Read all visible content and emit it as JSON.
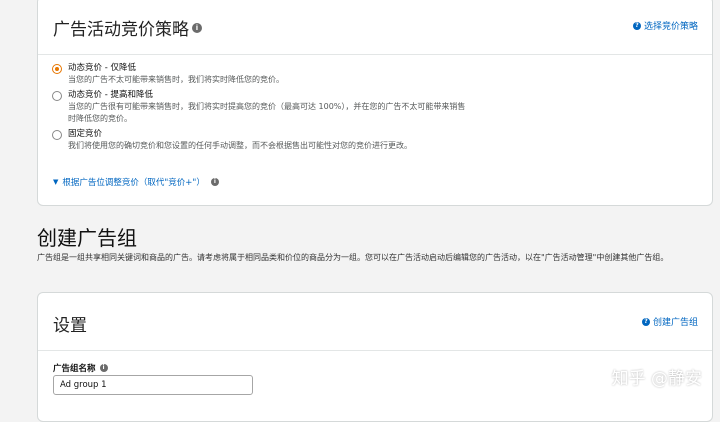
{
  "strategy": {
    "title": "广告活动竞价策略",
    "info_icon": "info-icon",
    "help_link": "选择竞价策略",
    "options": [
      {
        "label": "动态竞价 - 仅降低",
        "desc": "当您的广告不太可能带来销售时，我们将实时降低您的竞价。",
        "selected": true
      },
      {
        "label": "动态竞价 - 提高和降低",
        "desc": "当您的广告很有可能带来销售时，我们将实时提高您的竞价（最高可达 100%），并在您的广告不太可能带来销售时降低您的竞价。",
        "selected": false
      },
      {
        "label": "固定竞价",
        "desc": "我们将使用您的确切竞价和您设置的任何手动调整，而不会根据售出可能性对您的竞价进行更改。",
        "selected": false
      }
    ],
    "adjust_link": "根据广告位调整竞价（取代\"竞价+\"）"
  },
  "ad_group": {
    "title": "创建广告组",
    "description": "广告组是一组共享相同关键词和商品的广告。请考虑将属于相同品类和价位的商品分为一组。您可以在广告活动启动后编辑您的广告活动，以在\"广告活动管理\"中创建其他广告组。"
  },
  "settings": {
    "title": "设置",
    "help_link": "创建广告组",
    "name_label": "广告组名称",
    "name_value": "Ad group 1"
  },
  "watermark": "知乎 @静安",
  "colors": {
    "link": "#0066c0",
    "radio_selected": "#e77600",
    "card_border": "#d5d9d9"
  }
}
